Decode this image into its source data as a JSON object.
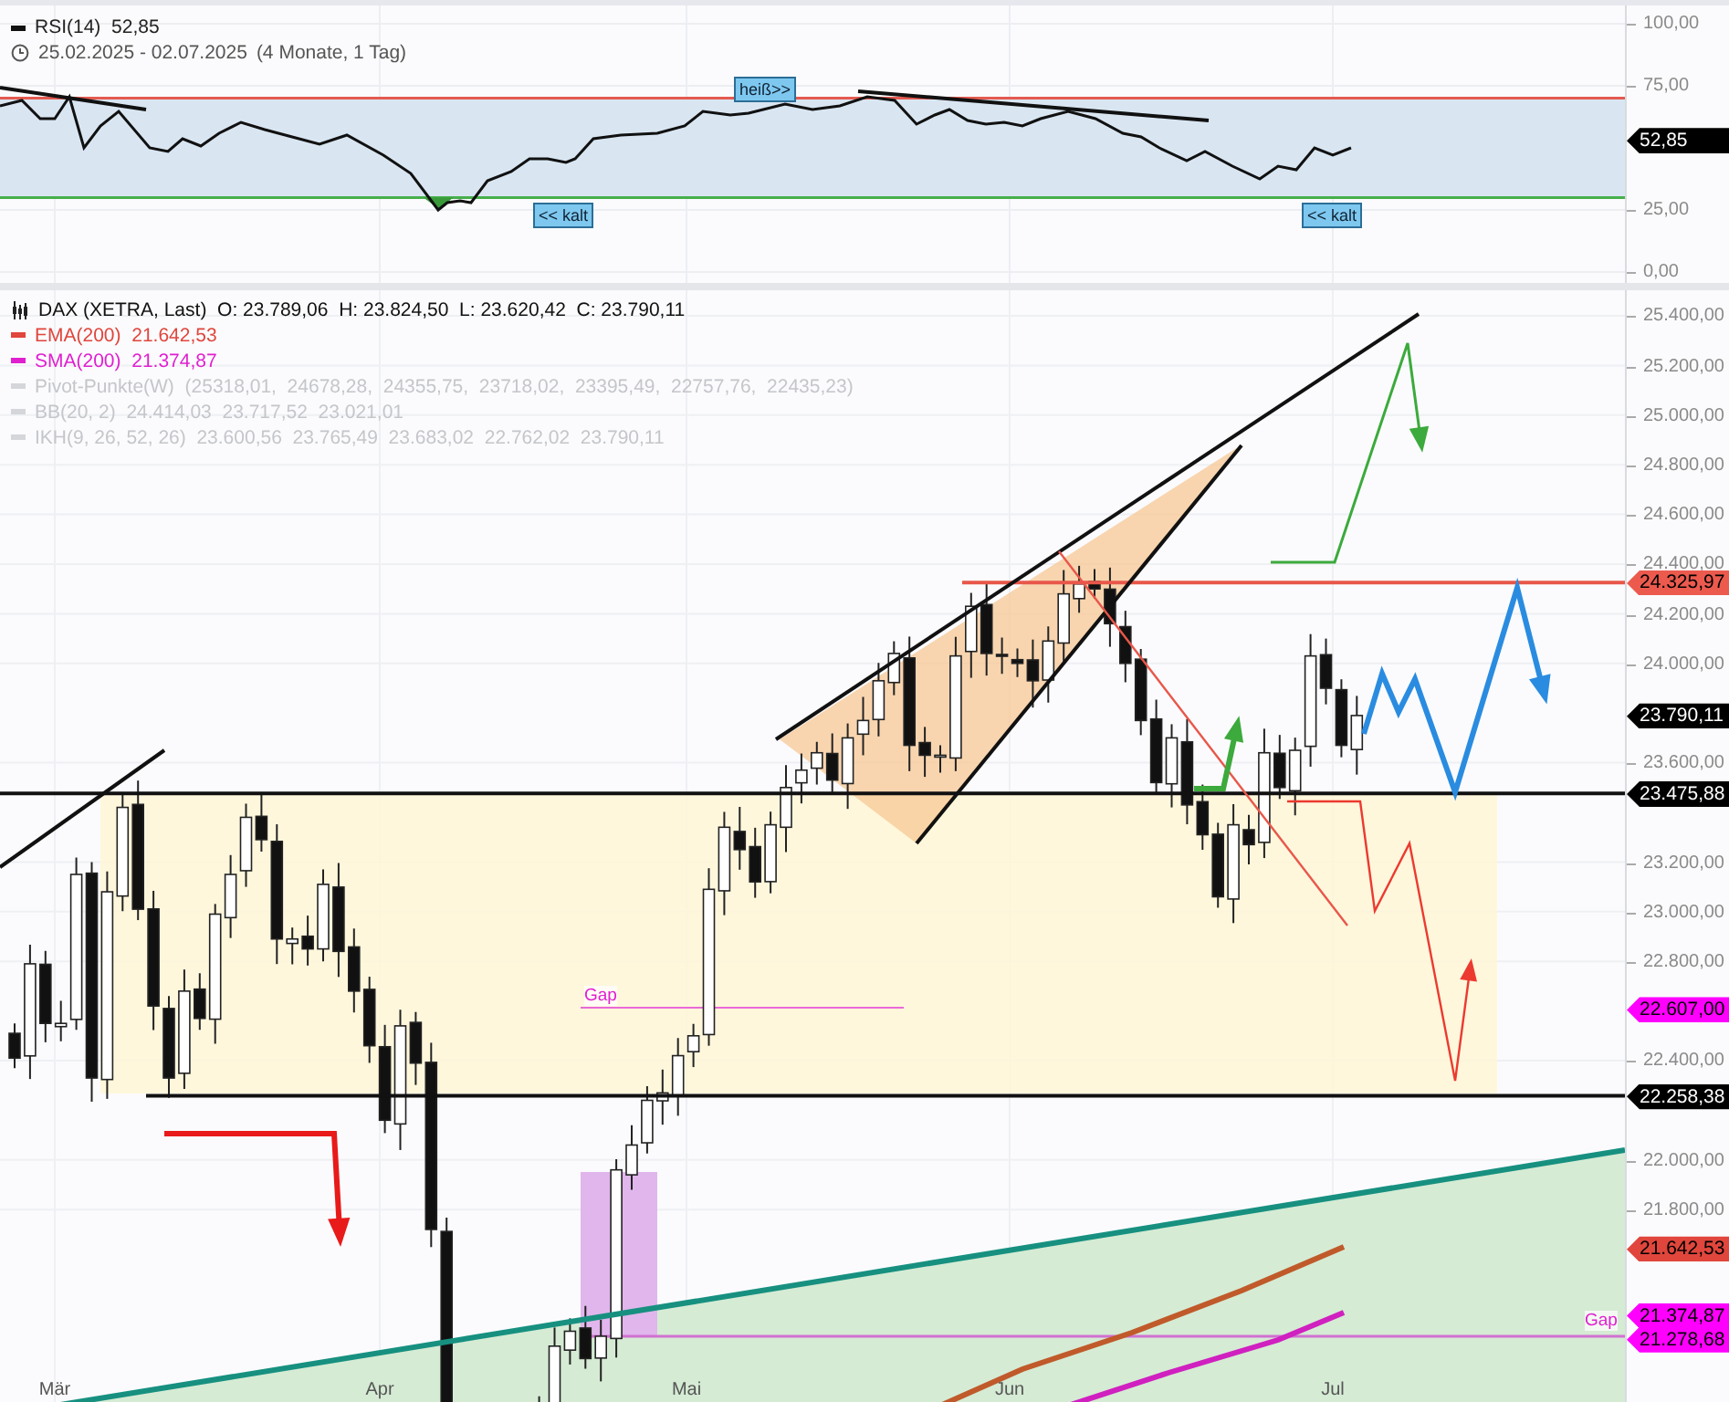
{
  "rsi_panel": {
    "legend": {
      "name": "RSI(14)",
      "value": "52,85",
      "date_range": "25.02.2025 - 02.07.2025",
      "duration": "(4 Monate, 1 Tag)"
    },
    "zone_labels": [
      "heiß>>",
      "<< kalt",
      "<< kalt"
    ],
    "axis_ticks": [
      "100,00",
      "75,00",
      "25,00",
      "0,00"
    ],
    "current_value": "52,85"
  },
  "price_panel": {
    "legend": [
      {
        "kind": "main",
        "text": "DAX (XETRA, Last)  O: 23.789,06  H: 23.824,50  L: 23.620,42  C: 23.790,11"
      },
      {
        "kind": "line",
        "text": "EMA(200)  21.642,53",
        "color": "#e0463c"
      },
      {
        "kind": "line",
        "text": "SMA(200)  21.374,87",
        "color": "#e020d0"
      },
      {
        "kind": "faded",
        "text": "Pivot-Punkte(W)  (25318,01,  24678,28,  24355,75,  23718,02,  23395,49,  22757,76,  22435,23)"
      },
      {
        "kind": "faded",
        "text": "BB(20, 2)  24.414,03  23.717,52  23.021,01"
      },
      {
        "kind": "faded",
        "text": "IKH(9, 26, 52, 26)  23.600,56  23.765,49  23.683,02  22.762,02  23.790,11"
      }
    ],
    "gap_labels": [
      "Gap",
      "Gap"
    ],
    "axis_ticks": [
      "25.400,00",
      "25.200,00",
      "25.000,00",
      "24.800,00",
      "24.600,00",
      "24.400,00",
      "24.200,00",
      "24.000,00",
      "23.600,00",
      "23.200,00",
      "23.000,00",
      "22.800,00",
      "22.400,00",
      "22.000,00",
      "21.800,00"
    ],
    "price_labels": [
      {
        "text": "24.325,97",
        "color": "#ec5a4e"
      },
      {
        "text": "23.790,11",
        "color": "#000000"
      },
      {
        "text": "23.475,88",
        "color": "#000000"
      },
      {
        "text": "22.607,00",
        "color": "#ff00ff"
      },
      {
        "text": "22.258,38",
        "color": "#000000"
      },
      {
        "text": "21.642,53",
        "color": "#e0463c"
      },
      {
        "text": "21.374,87",
        "color": "#ff00ff"
      },
      {
        "text": "21.278,68",
        "color": "#ff00ff"
      }
    ],
    "x_ticks": [
      "Mär",
      "Apr",
      "Mai",
      "Jun",
      "Jul"
    ]
  }
}
